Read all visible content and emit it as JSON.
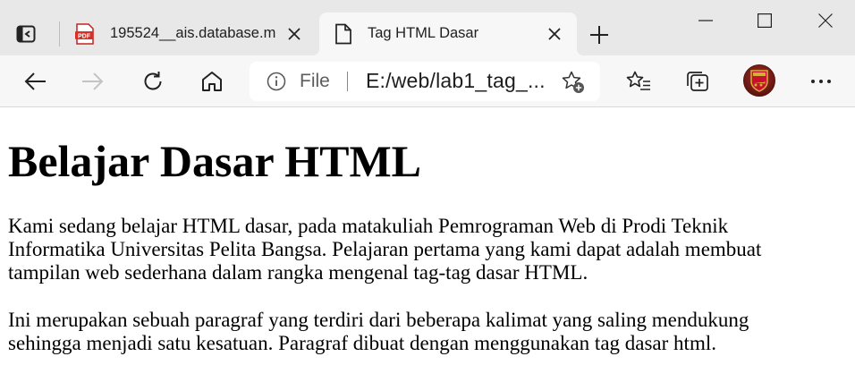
{
  "browser": {
    "tabs": [
      {
        "title": "195524__ais.database.m",
        "icon": "pdf-icon",
        "icon_label": "PDF",
        "active": false
      },
      {
        "title": "Tag HTML Dasar",
        "icon": "document-icon",
        "active": true
      }
    ],
    "address_bar": {
      "scheme_label": "File",
      "url": "E:/web/lab1_tag_..."
    },
    "profile": {
      "icon": "arsenal-crest-icon"
    },
    "colors": {
      "tabstrip": "#e8e8e8",
      "toolbar": "#f7f7f7",
      "pdf_red": "#d93025"
    }
  },
  "page": {
    "heading": "Belajar Dasar HTML",
    "paragraphs": [
      "Kami sedang belajar HTML dasar, pada matakuliah Pemrograman Web di Prodi Teknik Informatika Universitas Pelita Bangsa. Pelajaran pertama yang kami dapat adalah membuat tampilan web sederhana dalam rangka mengenal tag-tag dasar HTML.",
      "Ini merupakan sebuah paragraf yang terdiri dari beberapa kalimat yang saling mendukung sehingga menjadi satu kesatuan. Paragraf dibuat dengan menggunakan tag dasar html."
    ]
  }
}
